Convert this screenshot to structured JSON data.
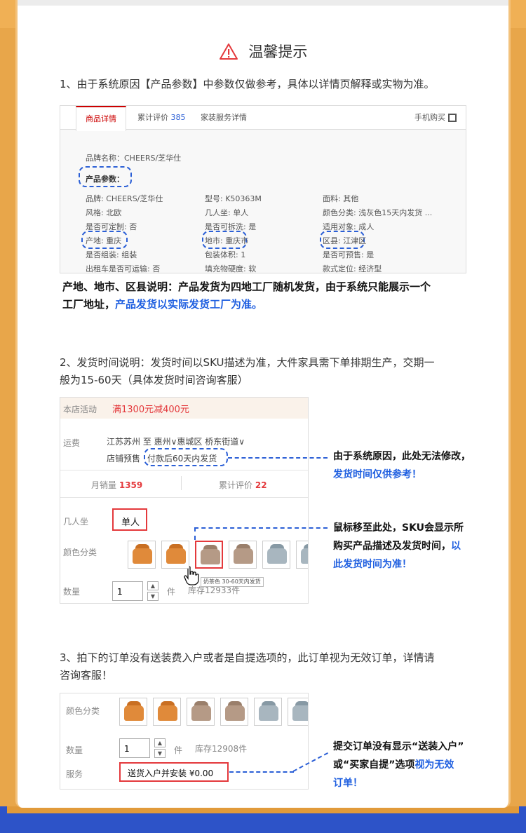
{
  "title": "温馨提示",
  "section1": {
    "text": "1、由于系统原因【产品参数】中参数仅做参考，具体以详情页解释或实物为准。",
    "tabs": {
      "detail": "商品详情",
      "reviews": "累计评价",
      "reviews_count": "385",
      "service": "家装服务详情",
      "mobile": "手机购买"
    },
    "brand_name": "品牌名称：CHEERS/芝华仕",
    "params_label": "产品参数：",
    "params": [
      [
        "品牌: CHEERS/芝华仕",
        "型号: K50363M",
        "面料: 其他"
      ],
      [
        "风格: 北欧",
        "几人坐: 单人",
        "颜色分类: 浅灰色15天内发货 ..."
      ],
      [
        "是否可定制: 否",
        "是否可拆洗: 是",
        "适用对象: 成人"
      ],
      [
        "产地: 重庆",
        "地市: 重庆市",
        "区县: 江津区"
      ],
      [
        "是否组装: 组装",
        "包装体积: 1",
        "是否可预售: 是"
      ],
      [
        "出租车是否可运输: 否",
        "填充物硬度: 软",
        "款式定位: 经济型"
      ]
    ],
    "note_line1": "产地、地市、区县说明：产品发货为四地工厂随机发货，由于系统只能展示一个",
    "note_line2_a": "工厂地址，",
    "note_line2_b": "产品发货以实际发货工厂为准。"
  },
  "section2": {
    "text_line1": "2、发货时间说明：发货时间以SKU描述为准，大件家具需下单排期生产，交期一",
    "text_line2": "般为15-60天（具体发货时间咨询客服）",
    "promo_label": "本店活动",
    "promo_value": "满1300元减400元",
    "ship_label": "运费",
    "ship_route": "江苏苏州  至  惠州∨惠城区  桥东街道∨",
    "presale_a": "店铺预售",
    "presale_b": "付款后60天内发货",
    "monthly_label": "月销量",
    "monthly_value": "1359",
    "reviews_label": "累计评价",
    "reviews_value": "22",
    "seat_label": "几人坐",
    "seat_value": "单人",
    "color_label": "颜色分类",
    "tooltip": "奶茶色  30-60天内发货",
    "qty_label": "数量",
    "qty_value": "1",
    "qty_unit": "件",
    "stock": "库存12933件",
    "note1_a": "由于系统原因，此处无法修改，",
    "note1_b": "发货时间仅供参考！",
    "note2_a": "鼠标移至此处，SKU会显示所",
    "note2_b": "购买产品描述及发货时间，",
    "note2_c": "以",
    "note2_d": "此发货时间为准！"
  },
  "section3": {
    "text_line1": "3、拍下的订单没有送装费入户或者是自提选项的，此订单视为无效订单，详情请",
    "text_line2": "咨询客服！",
    "color_label": "颜色分类",
    "qty_label": "数量",
    "qty_value": "1",
    "qty_unit": "件",
    "stock": "库存12908件",
    "service_label": "服务",
    "service_value": "送货入户并安装  ¥0.00",
    "note_a": "提交订单没有显示“送装入户”",
    "note_b": "或“买家自提”选项",
    "note_c": "视为无效",
    "note_d": "订单！"
  },
  "colors": {
    "accent_blue": "#1f5fe0",
    "red": "#e4393c",
    "frame_orange": "#e8a64a",
    "frame_blue": "#2d53c8"
  }
}
